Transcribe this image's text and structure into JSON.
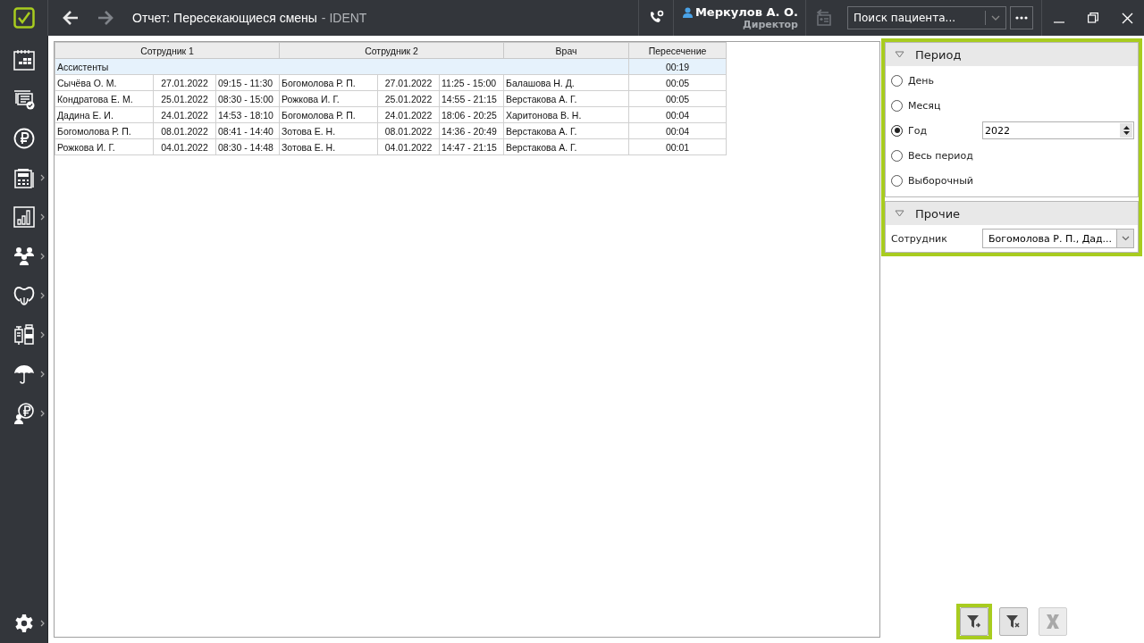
{
  "title_bar": {
    "title": "Отчет: Пересекающиеся смены",
    "separator": "-",
    "app_name": "IDENT",
    "back_disabled": false,
    "forward_disabled": true
  },
  "user": {
    "name": "Меркулов А. О.",
    "role": "Директор"
  },
  "search": {
    "placeholder": "Поиск пациента..."
  },
  "sidebar": {
    "items": [
      {
        "kind": "calendar",
        "has_submenu": false
      },
      {
        "kind": "tasks",
        "has_submenu": false
      },
      {
        "kind": "ruble",
        "has_submenu": false
      },
      {
        "kind": "cashbox",
        "has_submenu": true
      },
      {
        "kind": "chart",
        "has_submenu": true
      },
      {
        "kind": "people",
        "has_submenu": true
      },
      {
        "kind": "tooth",
        "has_submenu": true
      },
      {
        "kind": "supplies",
        "has_submenu": true
      },
      {
        "kind": "umbrella",
        "has_submenu": true
      },
      {
        "kind": "payer",
        "has_submenu": true
      }
    ],
    "settings": {
      "has_submenu": true
    }
  },
  "table": {
    "column_groups": [
      {
        "label": "Сотрудник 1"
      },
      {
        "label": "Сотрудник 2"
      },
      {
        "label": "Врач"
      },
      {
        "label": "Пересечение"
      }
    ],
    "group": {
      "label": "Ассистенты",
      "total": "00:19"
    },
    "rows": [
      [
        "Сычёва О. М.",
        "27.01.2022",
        "09:15 - 11:30",
        "Богомолова Р. П.",
        "27.01.2022",
        "11:25 - 15:00",
        "Балашова Н. Д.",
        "00:05"
      ],
      [
        "Кондратова Е. М.",
        "25.01.2022",
        "08:30 - 15:00",
        "Рожкова И. Г.",
        "25.01.2022",
        "14:55 - 21:15",
        "Верстакова А. Г.",
        "00:05"
      ],
      [
        "Дадина Е. И.",
        "24.01.2022",
        "14:53 - 18:10",
        "Богомолова Р. П.",
        "24.01.2022",
        "18:06 - 20:25",
        "Харитонова В. Н.",
        "00:04"
      ],
      [
        "Богомолова Р. П.",
        "08.01.2022",
        "08:41 - 14:40",
        "Зотова Е. Н.",
        "08.01.2022",
        "14:36 - 20:49",
        "Верстакова А. Г.",
        "00:04"
      ],
      [
        "Рожкова И. Г.",
        "04.01.2022",
        "08:30 - 14:48",
        "Зотова Е. Н.",
        "04.01.2022",
        "14:47 - 21:15",
        "Верстакова А. Г.",
        "00:01"
      ]
    ]
  },
  "filters": {
    "highlighted": true,
    "period": {
      "title": "Период",
      "expanded": true,
      "options": [
        {
          "label": "День",
          "selected": false
        },
        {
          "label": "Месяц",
          "selected": false
        },
        {
          "label": "Год",
          "selected": true,
          "value": "2022"
        },
        {
          "label": "Весь период",
          "selected": false
        },
        {
          "label": "Выборочный",
          "selected": false
        }
      ]
    },
    "other": {
      "title": "Прочие",
      "expanded": true,
      "employee_label": "Сотрудник",
      "employee_value": "Богомолова Р. П., Дад..."
    }
  },
  "actions": [
    {
      "kind": "apply",
      "highlighted": true,
      "disabled": false
    },
    {
      "kind": "clear",
      "highlighted": false,
      "disabled": false
    },
    {
      "kind": "export",
      "highlighted": false,
      "disabled": true
    }
  ]
}
